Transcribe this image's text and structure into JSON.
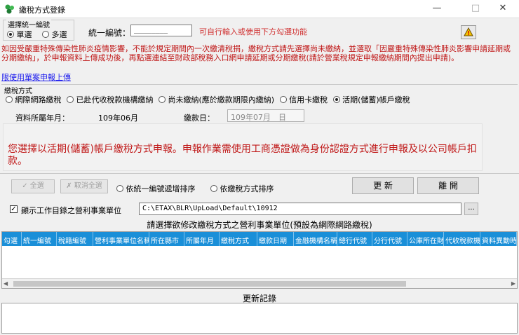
{
  "window": {
    "title": "繳稅方式登錄"
  },
  "selection": {
    "legend": "選擇統一編號",
    "single_label": "單選",
    "multi_label": "多選",
    "selected": "single"
  },
  "uid": {
    "label": "統一編號：",
    "value": "________",
    "hint": "可自行輸入或使用下方勾選功能"
  },
  "notice": {
    "text": "如因受嚴重特殊傳染性肺炎疫情影響，不能於規定期間內一次繳清稅捐，繳稅方式請先選擇尚未繳納，並選取「因嚴重特殊傳染性肺炎影響申請延期或分期繳納」，於申報資料上傳成功後，再點選連結至財政部稅務入口網申請延期或分期繳稅(請於營業稅規定申報繳納期間內提出申請)。",
    "link": "限使用單案申報上傳"
  },
  "payment_method": {
    "legend": "繳稅方式",
    "options": [
      "網際網路繳稅",
      "已赴代收稅款機構繳納",
      "尚未繳納(應於繳款期限內繳納)",
      "信用卡繳稅",
      "活期(儲蓄)帳戶繳稅"
    ],
    "selected_index": 4
  },
  "period": {
    "label": "資料所屬年月：",
    "value": "109年06月"
  },
  "due_date": {
    "label": "繳款日：",
    "value": "109年07月　日"
  },
  "message": "您選擇以活期(儲蓄)帳戶繳稅方式申報。申報作業需使用工商憑證做為身份認證方式進行申報及以公司帳戶扣款。",
  "actions": {
    "select_all": "全選",
    "deselect_all": "取消全選",
    "sort_by_uid": "依統一編號遞增排序",
    "sort_by_method": "依繳稅方式排序",
    "refresh": "更 新",
    "leave": "離 開"
  },
  "directory": {
    "checkbox_label": "顯示工作目錄之營利事業單位",
    "checked": true,
    "path": "C:\\ETAX\\BLR\\UpLoad\\Default\\10912",
    "browse_label": "..."
  },
  "grid": {
    "caption": "請選擇欲修改繳稅方式之營利事業單位(預設為網際網路繳稅)",
    "columns": [
      "勾選",
      "統一編號",
      "稅籍編號",
      "營利事業單位名稱",
      "所在縣市",
      "所屬年月",
      "繳稅方式",
      "繳款日期",
      "金融機構名稱",
      "總行代號",
      "分行代號",
      "公庫所在財",
      "代收稅款機",
      "資料異動時"
    ]
  },
  "log": {
    "caption": "更新記錄"
  },
  "colors": {
    "accent": "#1a8fd8",
    "warning": "#c01818",
    "link": "#1a1aee"
  }
}
